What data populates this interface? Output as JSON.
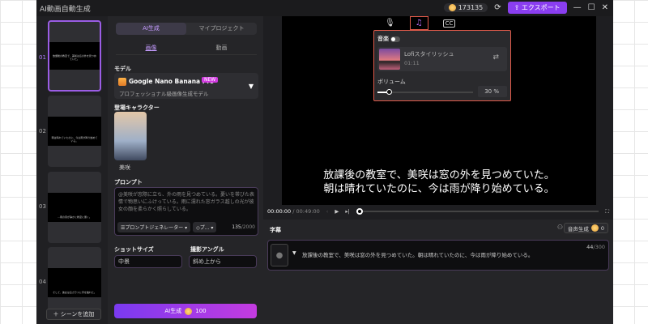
{
  "app": {
    "title": "AI動画自動生成",
    "coins": "173135",
    "export_label": "エクスポート"
  },
  "scenes": [
    {
      "num": "01",
      "caption": "放課後の教室で、美咲は窓の外を見つめていた。"
    },
    {
      "num": "02",
      "caption": "朝は晴れていたのに、今は雨が降り始めている。"
    },
    {
      "num": "03",
      "caption": "…雨の音が静かに教室に響く。"
    },
    {
      "num": "04",
      "caption": "そして、彼女は窓ガラスに手を触れた。"
    }
  ],
  "add_scene": "シーンを追加",
  "panel": {
    "tabs": [
      "AI生成",
      "マイプロジェクト"
    ],
    "subtabs": [
      "画像",
      "動画"
    ],
    "model_label": "モデル",
    "model_name": "Google Nano Banana Pro",
    "model_badge": "NEW",
    "model_desc": "プロフェッショナル級画像生成モデル",
    "character_label": "登場キャラクター",
    "character_name": "美咲",
    "prompt_label": "プロンプト",
    "prompt_text": "@美咲が窓際に立ち、外の雨を見つめている。憂いを帯びた表情で物思いにふけっている。雨に濡れた窓ガラス越しの光が彼女の顔を柔らかく照らしている。",
    "prompt_generator": "プロンプトジェネレーター",
    "preset": "プ...",
    "char_count": "135",
    "char_max": "/2000",
    "shot_size_label": "ショットサイズ",
    "shot_size": "中景",
    "angle_label": "撮影アングル",
    "angle": "斜め上から",
    "generate_label": "AI生成",
    "generate_cost": "100"
  },
  "preview": {
    "subtitle_line1": "放課後の教室で、美咲は窓の外を見つめていた。",
    "subtitle_line2": "朝は晴れていたのに、今は雨が降り始めている。",
    "time_current": "00:00:00",
    "time_total": "/ 00:49:00"
  },
  "music": {
    "label": "音楽",
    "enabled": false,
    "track_name": "Lofiスタイリッシュ",
    "track_duration": "01:11",
    "volume_label": "ボリューム",
    "volume": "30",
    "volume_unit": "%"
  },
  "subtitles": {
    "label": "字幕",
    "voice_button": "音声生成",
    "voice_cost": "0",
    "text": "放課後の教室で、美咲は窓の外を見つめていた。朝は晴れていたのに、今は雨が降り始めている。",
    "count": "44",
    "max": "/300"
  }
}
